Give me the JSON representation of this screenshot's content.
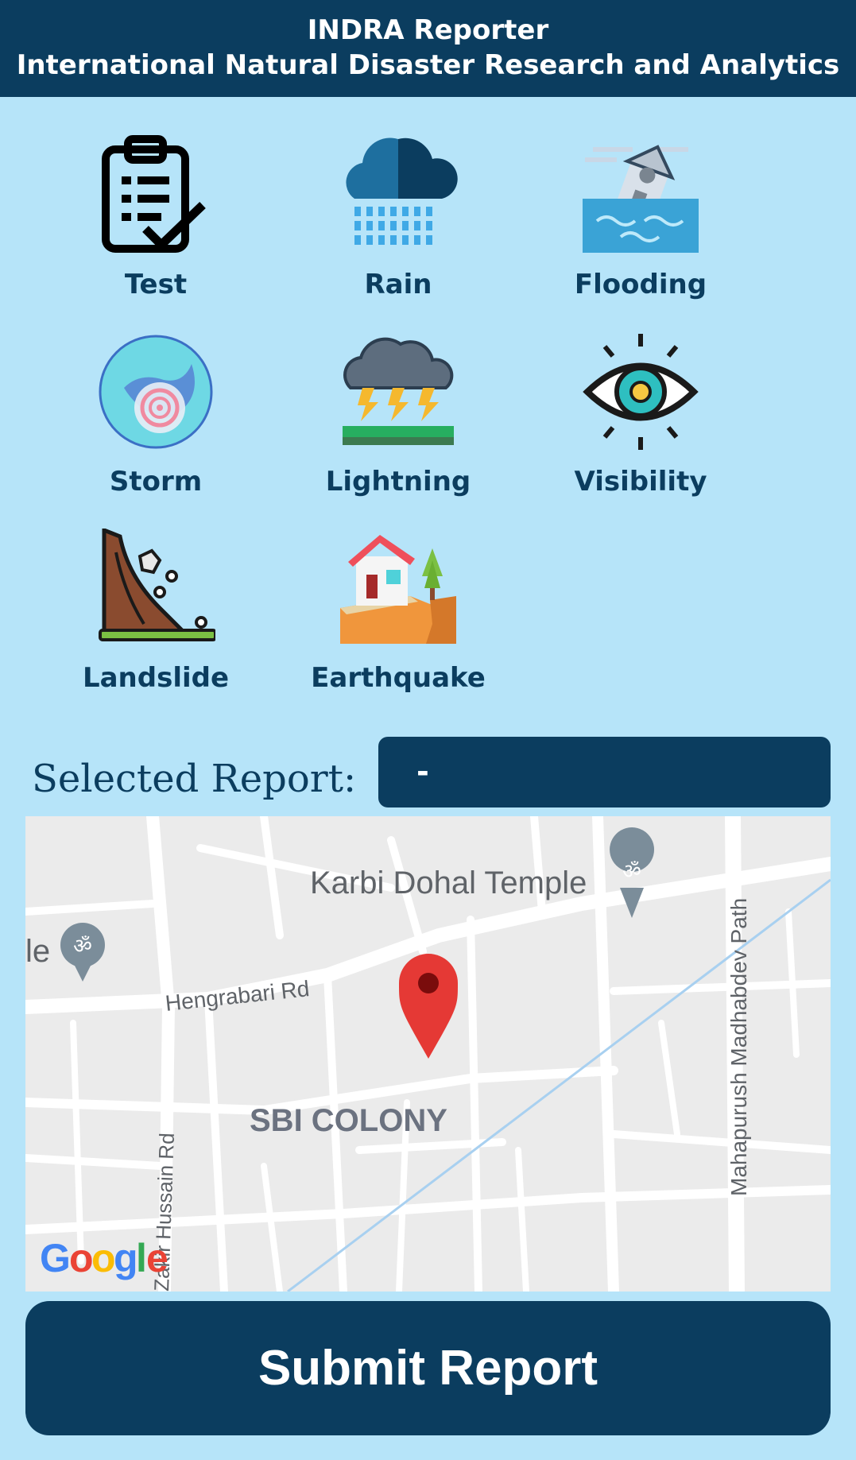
{
  "header": {
    "title": "INDRA Reporter",
    "subtitle": "International Natural Disaster Research and Analytics"
  },
  "reports": [
    {
      "label": "Test",
      "icon": "clipboard-check-icon"
    },
    {
      "label": "Rain",
      "icon": "rain-cloud-icon"
    },
    {
      "label": "Flooding",
      "icon": "flooded-house-icon"
    },
    {
      "label": "Storm",
      "icon": "cyclone-globe-icon"
    },
    {
      "label": "Lightning",
      "icon": "thunderstorm-icon"
    },
    {
      "label": "Visibility",
      "icon": "eye-icon"
    },
    {
      "label": "Landslide",
      "icon": "landslide-icon"
    },
    {
      "label": "Earthquake",
      "icon": "earthquake-house-icon"
    }
  ],
  "selected": {
    "label": "Selected Report:",
    "value": "-"
  },
  "map": {
    "places": {
      "temple": "Karbi Dohal Temple",
      "temple_left": "le",
      "road1": "Hengrabari Rd",
      "road2": "Zakir Hussain Rd",
      "road3": "Mahapurush Madhabdev Path",
      "area": "SBI COLONY"
    },
    "logo": "Google"
  },
  "submit_label": "Submit Report",
  "colors": {
    "primary": "#0b3d5f",
    "background": "#b6e4f9",
    "map_bg": "#ebebeb",
    "pin": "#e53935"
  }
}
